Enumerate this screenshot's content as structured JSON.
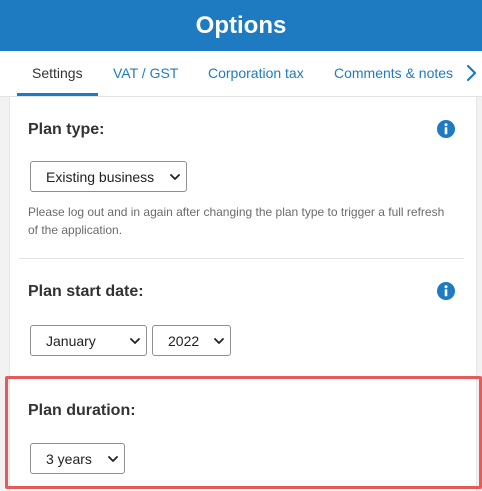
{
  "header": {
    "title": "Options"
  },
  "tabs": [
    {
      "label": "Settings",
      "active": true
    },
    {
      "label": "VAT / GST",
      "active": false
    },
    {
      "label": "Corporation tax",
      "active": false
    },
    {
      "label": "Comments & notes",
      "active": false
    }
  ],
  "sections": {
    "plan_type": {
      "title": "Plan type:",
      "select_value": "Existing business",
      "help": "Please log out and in again after changing the plan type to trigger a full refresh of the application."
    },
    "plan_start_date": {
      "title": "Plan start date:",
      "month_value": "January",
      "year_value": "2022"
    },
    "plan_duration": {
      "title": "Plan duration:",
      "select_value": "3 years"
    }
  },
  "colors": {
    "accent": "#1f7bc1",
    "highlight_border": "#e65a5a",
    "info_icon": "#1f7bc1"
  },
  "icons": {
    "info": "info-circle-icon",
    "tab_next": "chevron-right-icon",
    "select_caret": "chevron-down-icon"
  }
}
